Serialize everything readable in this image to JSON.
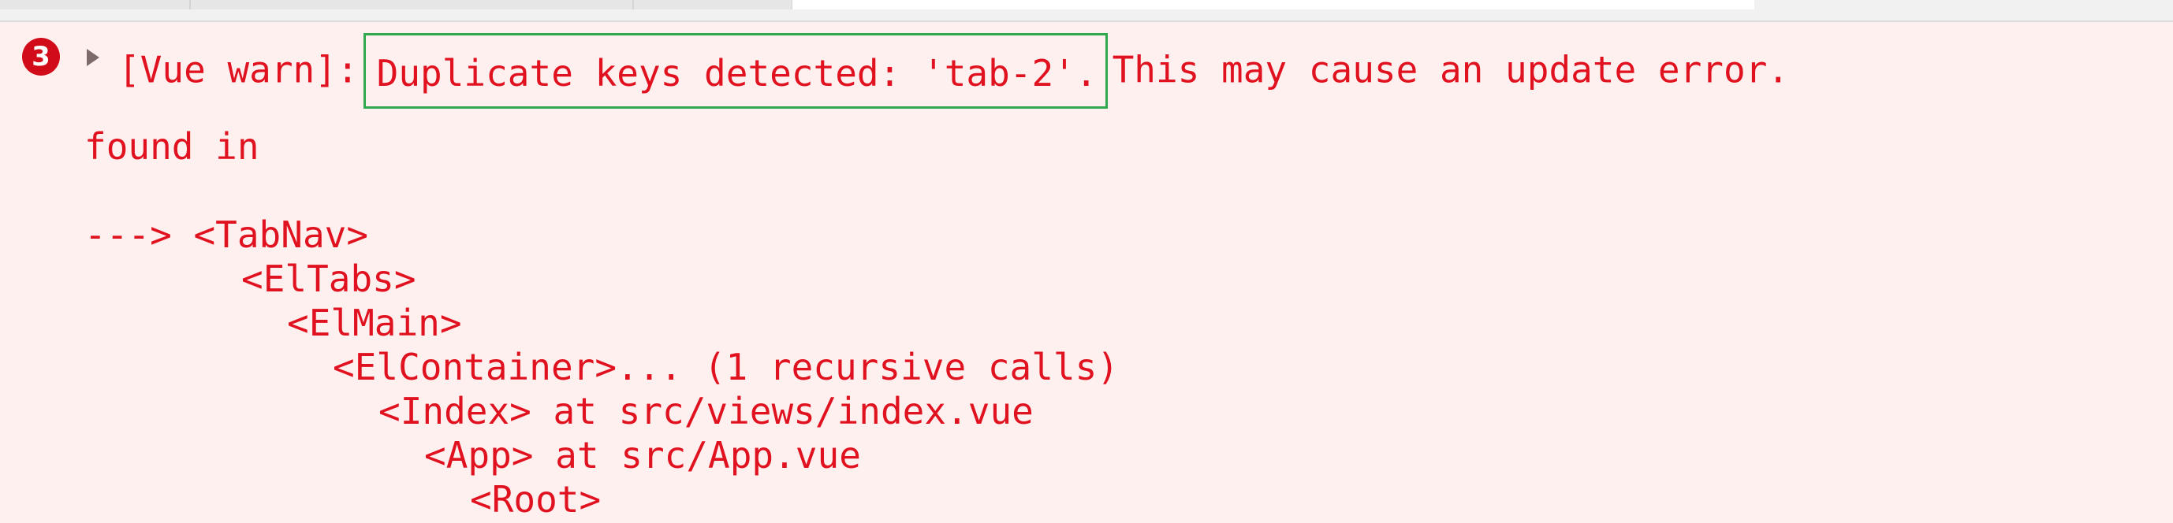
{
  "console": {
    "message_count": "3",
    "prefix": "[Vue warn]:",
    "highlighted": "Duplicate keys detected: 'tab-2'.",
    "suffix": "This may cause an update error.",
    "found_in": "found in",
    "stack": [
      "---> <TabNav>",
      "<ElTabs>",
      "<ElMain>",
      "<ElContainer>... (1 recursive calls)",
      "<Index> at src/views/index.vue",
      "<App> at src/App.vue",
      "<Root>"
    ]
  },
  "colors": {
    "background": "#fff0f0",
    "error_text": "#e0121f",
    "badge": "#d10b1a",
    "highlight_border": "#2fa84f"
  }
}
